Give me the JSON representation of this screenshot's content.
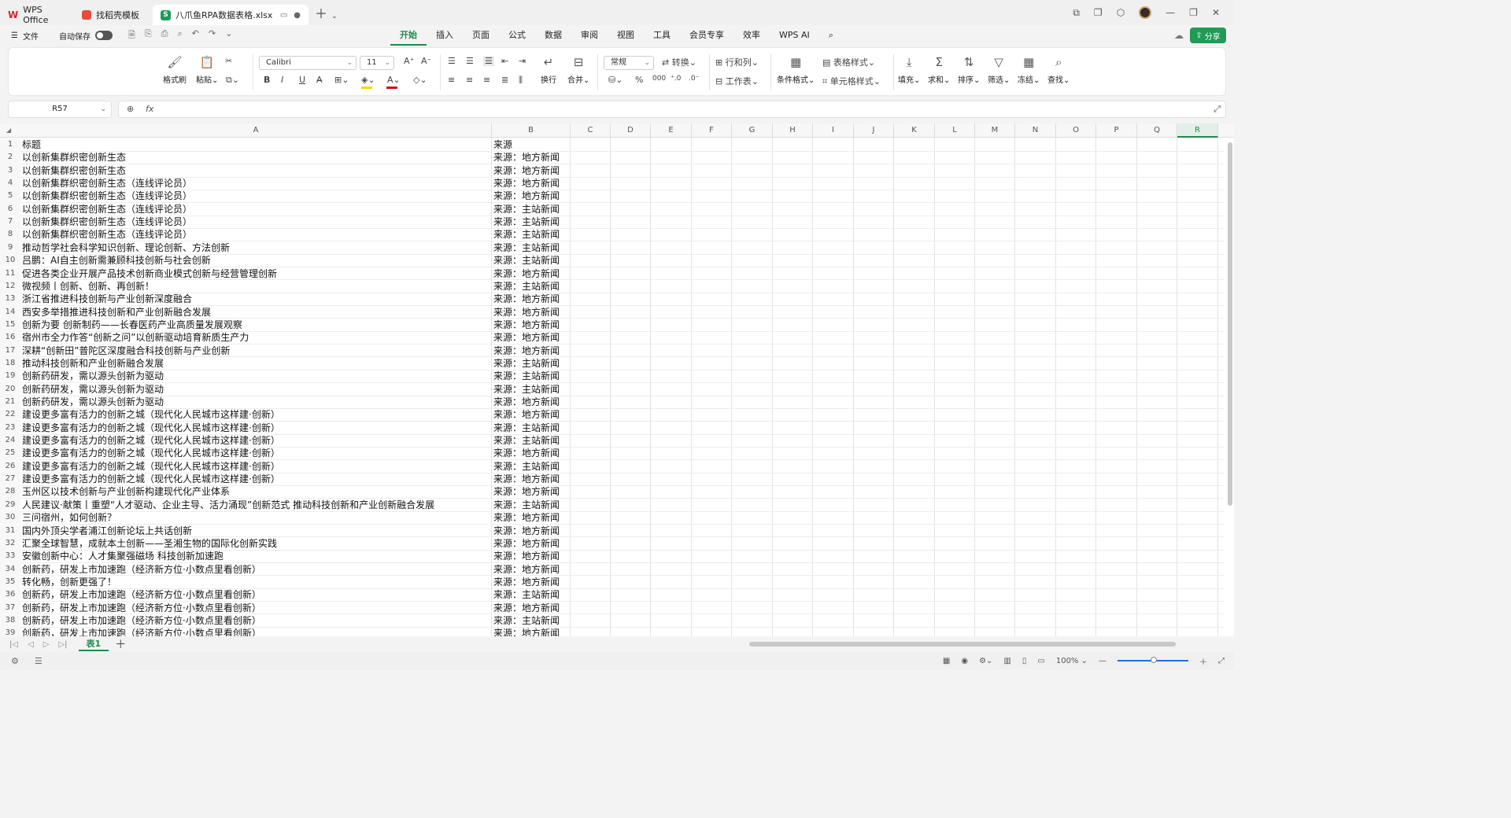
{
  "tabs": [
    {
      "label": "WPS Office",
      "icon": "wps-logo-icon"
    },
    {
      "label": "找稻壳模板",
      "icon": "daoke-logo-icon"
    },
    {
      "label": "八爪鱼RPA数据表格.xlsx",
      "icon": "spreadsheet-icon",
      "active": true
    }
  ],
  "menu": {
    "file": "文件",
    "autosave": "自动保存",
    "tabs": [
      "开始",
      "插入",
      "页面",
      "公式",
      "数据",
      "审阅",
      "视图",
      "工具",
      "会员专享",
      "效率",
      "WPS AI"
    ],
    "active_tab": "开始",
    "share": "分享"
  },
  "ribbon": {
    "format_painter": "格式刷",
    "paste": "粘贴",
    "font_name": "Calibri",
    "font_size": "11",
    "wrap": "换行",
    "merge": "合并",
    "number_format": "常规",
    "convert": "转换",
    "row_col": "行和列",
    "worksheet": "工作表",
    "cond_format": "条件格式",
    "table_style": "表格样式",
    "cell_style": "单元格样式",
    "fill": "填充",
    "sum": "求和",
    "sort": "排序",
    "filter": "筛选",
    "freeze": "冻结",
    "find": "查找",
    "percent": "%",
    "thousands": "000",
    "fx": "fx",
    "bold": "B",
    "italic": "I",
    "underline": "U"
  },
  "formula_bar": {
    "name_box": "R57",
    "formula": ""
  },
  "sheet": {
    "columns": [
      "A",
      "B",
      "C",
      "D",
      "E",
      "F",
      "G",
      "H",
      "I",
      "J",
      "K",
      "L",
      "M",
      "N",
      "O",
      "P",
      "Q",
      "R"
    ],
    "selected_column": "R",
    "rows": [
      {
        "n": "1",
        "a": "标题",
        "b": "来源"
      },
      {
        "n": "2",
        "a": "以创新集群织密创新生态",
        "b": "来源：地方新闻"
      },
      {
        "n": "3",
        "a": "以创新集群织密创新生态",
        "b": "来源：地方新闻"
      },
      {
        "n": "4",
        "a": "以创新集群织密创新生态（连线评论员）",
        "b": "来源：地方新闻"
      },
      {
        "n": "5",
        "a": "以创新集群织密创新生态（连线评论员）",
        "b": "来源：地方新闻"
      },
      {
        "n": "6",
        "a": "以创新集群织密创新生态（连线评论员）",
        "b": "来源：主站新闻"
      },
      {
        "n": "7",
        "a": "以创新集群织密创新生态（连线评论员）",
        "b": "来源：主站新闻"
      },
      {
        "n": "8",
        "a": "以创新集群织密创新生态（连线评论员）",
        "b": "来源：主站新闻"
      },
      {
        "n": "9",
        "a": "推动哲学社会科学知识创新、理论创新、方法创新",
        "b": "来源：主站新闻"
      },
      {
        "n": "10",
        "a": "吕鹏：AI自主创新需兼顾科技创新与社会创新",
        "b": "来源：主站新闻"
      },
      {
        "n": "11",
        "a": "促进各类企业开展产品技术创新商业模式创新与经营管理创新",
        "b": "来源：地方新闻"
      },
      {
        "n": "12",
        "a": "微视频丨创新、创新、再创新！",
        "b": "来源：主站新闻"
      },
      {
        "n": "13",
        "a": "浙江省推进科技创新与产业创新深度融合",
        "b": "来源：地方新闻"
      },
      {
        "n": "14",
        "a": "西安多举措推进科技创新和产业创新融合发展",
        "b": "来源：地方新闻"
      },
      {
        "n": "15",
        "a": "创新为要 创新制药——长春医药产业高质量发展观察",
        "b": "来源：地方新闻"
      },
      {
        "n": "16",
        "a": "宿州市全力作答“创新之问”以创新驱动培育新质生产力",
        "b": "来源：地方新闻"
      },
      {
        "n": "17",
        "a": "深耕“创新田”普陀区深度融合科技创新与产业创新",
        "b": "来源：地方新闻"
      },
      {
        "n": "18",
        "a": "推动科技创新和产业创新融合发展",
        "b": "来源：主站新闻"
      },
      {
        "n": "19",
        "a": "创新药研发，需以源头创新为驱动",
        "b": "来源：主站新闻"
      },
      {
        "n": "20",
        "a": "创新药研发，需以源头创新为驱动",
        "b": "来源：主站新闻"
      },
      {
        "n": "21",
        "a": "创新药研发，需以源头创新为驱动",
        "b": "来源：地方新闻"
      },
      {
        "n": "22",
        "a": "建设更多富有活力的创新之城（现代化人民城市这样建·创新）",
        "b": "来源：地方新闻"
      },
      {
        "n": "23",
        "a": "建设更多富有活力的创新之城（现代化人民城市这样建·创新）",
        "b": "来源：主站新闻"
      },
      {
        "n": "24",
        "a": "建设更多富有活力的创新之城（现代化人民城市这样建·创新）",
        "b": "来源：主站新闻"
      },
      {
        "n": "25",
        "a": "建设更多富有活力的创新之城（现代化人民城市这样建·创新）",
        "b": "来源：地方新闻"
      },
      {
        "n": "26",
        "a": "建设更多富有活力的创新之城（现代化人民城市这样建·创新）",
        "b": "来源：主站新闻"
      },
      {
        "n": "27",
        "a": "建设更多富有活力的创新之城（现代化人民城市这样建·创新）",
        "b": "来源：地方新闻"
      },
      {
        "n": "28",
        "a": "玉州区以技术创新与产业创新构建现代化产业体系",
        "b": "来源：地方新闻"
      },
      {
        "n": "29",
        "a": "人民建议·献策丨重塑“人才驱动、企业主导、活力涌现”创新范式 推动科技创新和产业创新融合发展",
        "b": "来源：主站新闻"
      },
      {
        "n": "30",
        "a": "三问宿州，如何创新？",
        "b": "来源：地方新闻"
      },
      {
        "n": "31",
        "a": "国内外顶尖学者浦江创新论坛上共话创新",
        "b": "来源：地方新闻"
      },
      {
        "n": "32",
        "a": "汇聚全球智慧，成就本土创新——圣湘生物的国际化创新实践",
        "b": "来源：地方新闻"
      },
      {
        "n": "33",
        "a": "安徽创新中心：人才集聚强磁场 科技创新加速跑",
        "b": "来源：地方新闻"
      },
      {
        "n": "34",
        "a": "创新药，研发上市加速跑（经济新方位·小数点里看创新）",
        "b": "来源：地方新闻"
      },
      {
        "n": "35",
        "a": "转化畅，创新更强了！",
        "b": "来源：地方新闻"
      },
      {
        "n": "36",
        "a": "创新药，研发上市加速跑（经济新方位·小数点里看创新）",
        "b": "来源：主站新闻"
      },
      {
        "n": "37",
        "a": "创新药，研发上市加速跑（经济新方位·小数点里看创新）",
        "b": "来源：地方新闻"
      },
      {
        "n": "38",
        "a": "创新药，研发上市加速跑（经济新方位·小数点里看创新）",
        "b": "来源：主站新闻"
      },
      {
        "n": "39",
        "a": "创新药，研发上市加速跑（经济新方位·小数点里看创新）",
        "b": "来源：地方新闻"
      }
    ]
  },
  "sheet_tabs": [
    "表1"
  ],
  "status": {
    "zoom": "100%"
  }
}
